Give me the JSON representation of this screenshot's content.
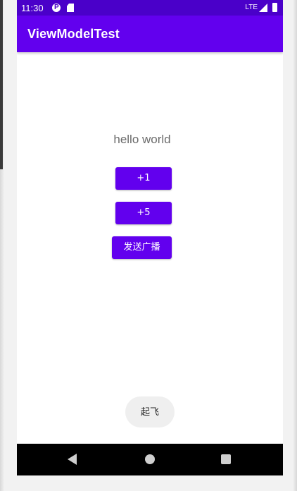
{
  "status_bar": {
    "time": "11:30",
    "network": "LTE",
    "icons": [
      "pocket-casts-icon",
      "sd-card-icon",
      "signal-icon",
      "battery-icon"
    ]
  },
  "app_bar": {
    "title": "ViewModelTest"
  },
  "main": {
    "text": "hello world",
    "buttons": {
      "plus_one": "+1",
      "plus_five": "+5",
      "broadcast": "发送广播"
    },
    "fab_label": "起飞"
  },
  "navigation": {
    "icons": [
      "back-icon",
      "home-icon",
      "recents-icon"
    ]
  },
  "colors": {
    "primary": "#6200ee",
    "status_bar": "#4a00c9",
    "nav_bar": "#000000"
  }
}
